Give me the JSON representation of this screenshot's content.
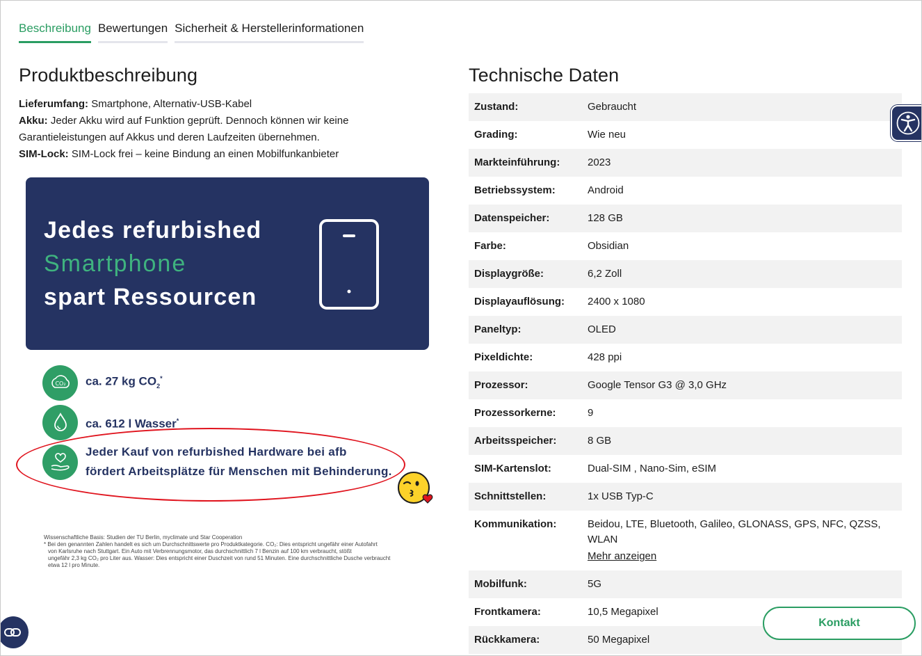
{
  "tabs": [
    {
      "label": "Beschreibung",
      "active": true
    },
    {
      "label": "Bewertungen",
      "active": false
    },
    {
      "label": "Sicherheit & Herstellerinformationen",
      "active": false
    }
  ],
  "description": {
    "title": "Produktbeschreibung",
    "lines": [
      {
        "key": "Lieferumfang:",
        "value": "Smartphone, Alternativ-USB-Kabel"
      },
      {
        "key": "Akku:",
        "value": "Jeder Akku wird auf Funktion geprüft. Dennoch können wir keine"
      },
      {
        "key": "",
        "value": "Garantieleistungen auf Akkus und deren Laufzeiten übernehmen."
      },
      {
        "key": "SIM-Lock:",
        "value": "SIM-Lock frei – keine Bindung an einen Mobilfunkanbieter"
      }
    ]
  },
  "banner": {
    "line1": "Jedes refurbished",
    "line2": "Smartphone",
    "line3": "spart Ressourcen",
    "icon": "smartphone-icon"
  },
  "facts": [
    {
      "icon": "co2-icon",
      "text": "ca. 27 kg CO",
      "sub": "2",
      "sup": "*"
    },
    {
      "icon": "water-drop-icon",
      "text": "ca. 612 l Wasser",
      "sup": "*"
    },
    {
      "icon": "heart-hand-icon",
      "line1": "Jeder Kauf von refurbished Hardware bei afb",
      "line2": "fördert Arbeitsplätze für Menschen mit Behinderung."
    }
  ],
  "footnote": {
    "line1": "Wissenschaftliche Basis: Studien der TU Berlin, myclimate und Star Cooperation",
    "line2": "*  Bei den genannten Zahlen handelt es sich um Durchschnittswerte pro Produktkategorie. CO₂: Dies entspricht ungefähr einer Autofahrt",
    "line3": "von Karlsruhe nach Stuttgart. Ein Auto mit Verbrennungsmotor, das durchschnittlich 7 l Benzin auf 100 km verbraucht, stößt",
    "line4": "ungefähr 2,3 kg CO₂ pro Liter aus. Wasser: Dies entspricht einer Duschzeit von rund 51 Minuten. Eine durchschnittliche Dusche verbraucht",
    "line5": "etwa 12 l pro Minute."
  },
  "specs": {
    "title": "Technische Daten",
    "rows": [
      {
        "key": "Zustand:",
        "value": "Gebraucht"
      },
      {
        "key": "Grading:",
        "value": "Wie neu"
      },
      {
        "key": "Markteinführung:",
        "value": "2023"
      },
      {
        "key": "Betriebssystem:",
        "value": "Android"
      },
      {
        "key": "Datenspeicher:",
        "value": "128 GB"
      },
      {
        "key": "Farbe:",
        "value": "Obsidian"
      },
      {
        "key": "Displaygröße:",
        "value": "6,2 Zoll"
      },
      {
        "key": "Displayauflösung:",
        "value": "2400 x 1080"
      },
      {
        "key": "Paneltyp:",
        "value": "OLED"
      },
      {
        "key": "Pixeldichte:",
        "value": "428 ppi"
      },
      {
        "key": "Prozessor:",
        "value": "Google Tensor G3 @ 3,0 GHz"
      },
      {
        "key": "Prozessorkerne:",
        "value": "9"
      },
      {
        "key": "Arbeitsspeicher:",
        "value": "8 GB"
      },
      {
        "key": "SIM-Kartenslot:",
        "value": "Dual-SIM , Nano-Sim, eSIM"
      },
      {
        "key": "Schnittstellen:",
        "value": "1x USB Typ-C"
      },
      {
        "key": "Kommunikation:",
        "value": "Beidou, LTE, Bluetooth, Galileo, GLONASS, GPS, NFC, QZSS, WLAN",
        "more": "Mehr anzeigen"
      },
      {
        "key": "Mobilfunk:",
        "value": "5G"
      },
      {
        "key": "Frontkamera:",
        "value": "10,5 Megapixel"
      },
      {
        "key": "Rückkamera:",
        "value": "50 Megapixel"
      }
    ]
  },
  "kontakt_label": "Kontakt",
  "icons": {
    "accessibility": "accessibility-icon",
    "chat": "chat-icon",
    "emoji": "kiss-emoji-icon"
  },
  "colors": {
    "accent_green": "#2a9d62",
    "navy": "#253362",
    "highlight_red": "#e0141e"
  }
}
